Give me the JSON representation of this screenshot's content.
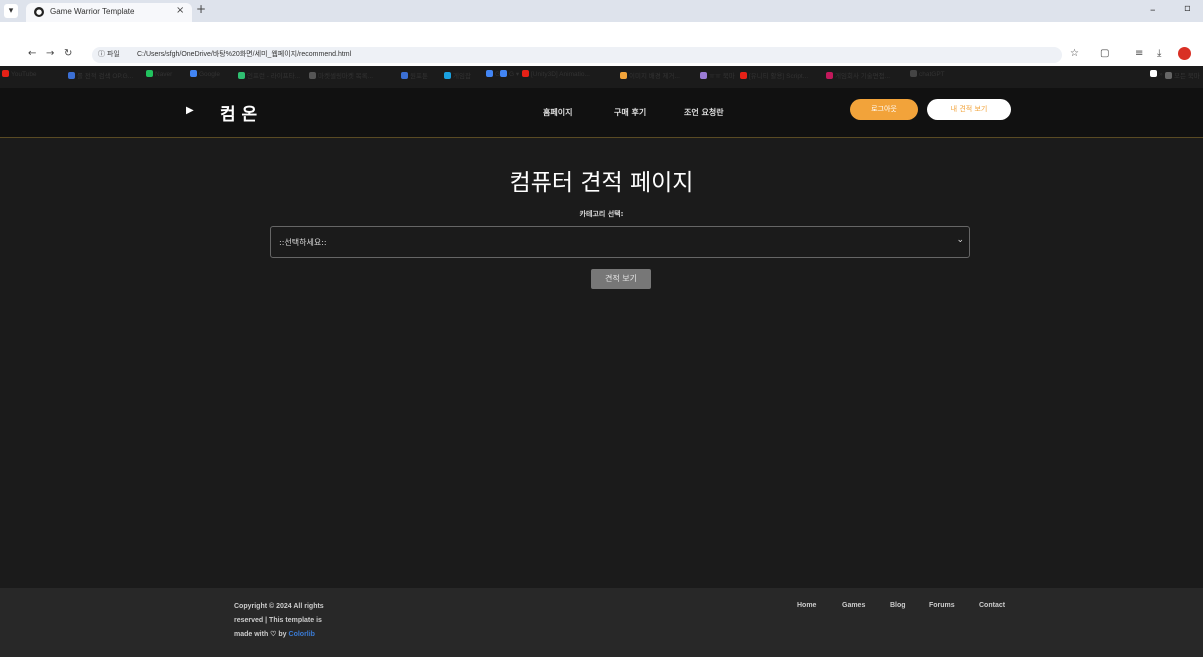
{
  "browser": {
    "menu_glyph": "▾",
    "tab_title": "Game Warrior Template",
    "tab_close": "×",
    "new_tab": "+",
    "minimize": "–",
    "maximize": "▫",
    "back": "←",
    "forward": "→",
    "reload": "↻",
    "url_info": "ⓘ 파일",
    "url": "C:/Users/sfgh/OneDrive/바탕%20화면/세미_웹페이지/recommend.html",
    "bookmarks": [
      {
        "label": "YouTube",
        "color": "#e62117"
      },
      {
        "label": "롤 전적 검색 OP.G...",
        "color": "#3b6fd4"
      },
      {
        "label": "Naver",
        "color": "#21c25e"
      },
      {
        "label": "Google",
        "color": "#4285f4"
      },
      {
        "label": "인프런 - 라이프타...",
        "color": "#2fbf71"
      },
      {
        "label": "마켓셀링마켓 목록...",
        "color": "#555555"
      },
      {
        "label": "원포툰",
        "color": "#3b6fd4"
      },
      {
        "label": "게임잡",
        "color": "#1aa1e0"
      },
      {
        "label": "G",
        "color": "#4285f4"
      },
      {
        "label": "G ▾",
        "color": "#4285f4"
      },
      {
        "label": "[Unity3D] Animatio...",
        "color": "#e62117"
      },
      {
        "label": "이미지 배경 제거...",
        "color": "#f2a33a"
      },
      {
        "label": "ㅠㅠ 북마",
        "color": "#9a7bd5"
      },
      {
        "label": "[유니티 활용] Script...",
        "color": "#e62117"
      },
      {
        "label": "게임회사 기술면접...",
        "color": "#c2185b"
      },
      {
        "label": "chatGPT",
        "color": "#444444"
      },
      {
        "label": "»",
        "color": "#ffffff"
      },
      {
        "label": "모든 북마",
        "color": "#666666"
      }
    ]
  },
  "header": {
    "cursor": "▶",
    "logo": "컴 온",
    "nav": [
      "홈페이지",
      "구매 후기",
      "조언 요청란"
    ],
    "login_button": "로그아웃",
    "my_quote_button": "내 견적 보기"
  },
  "main": {
    "title": "컴퓨터 견적 페이지",
    "category_label": "카테고리 선택:",
    "select_value": "::선택하세요::",
    "view_button": "견적 보기"
  },
  "footer": {
    "copyright_line1": "Copyright © 2024 All rights",
    "copyright_line2": "reserved | This template is",
    "copyright_line3_prefix": "made with ♡ by",
    "copyright_link": "Colorlib",
    "links": [
      "Home",
      "Games",
      "Blog",
      "Forums",
      "Contact"
    ]
  }
}
